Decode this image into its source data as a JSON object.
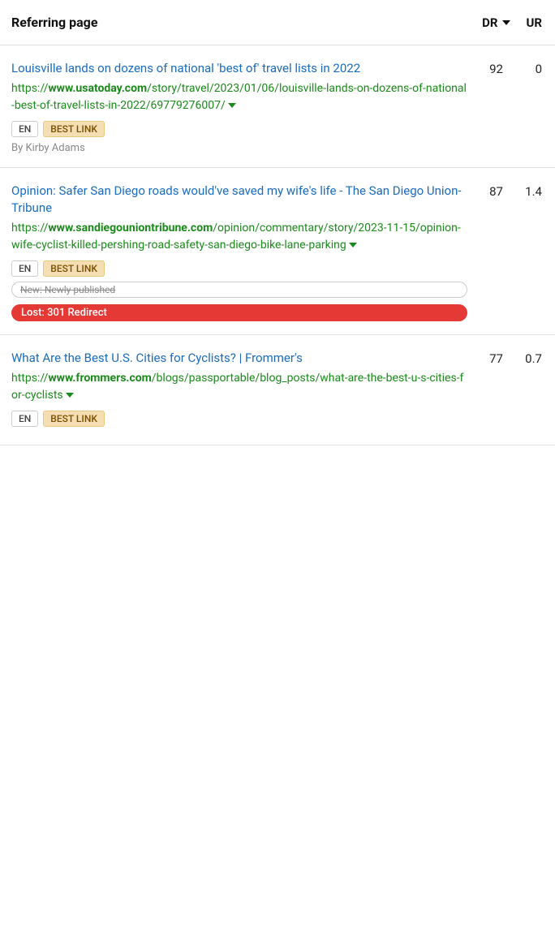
{
  "header": {
    "title": "Referring page",
    "col_dr": "DR",
    "col_ur": "UR"
  },
  "rows": [
    {
      "title": "Louisville lands on dozens of national 'best of' travel lists in 2022",
      "url_prefix": "https://",
      "url_domain": "www.usatoday.com",
      "url_path": "/story/travel/2023/01/06/louisville-lands-on-dozens-of-national-best-of-travel-lists-in-2022/69779276007/",
      "dr": "92",
      "ur": "0",
      "lang": "EN",
      "tag": "BEST LINK",
      "author": "By Kirby Adams",
      "statuses": []
    },
    {
      "title": "Opinion: Safer San Diego roads would've saved my wife's life - The San Diego Union-Tribune",
      "url_prefix": "https://",
      "url_domain": "www.sandiegouniontribune.com",
      "url_path": "/opinion/commentary/story/2023-11-15/opinion-wife-cyclist-killed-pershing-road-safety-san-diego-bike-lane-parking",
      "dr": "87",
      "ur": "1.4",
      "lang": "EN",
      "tag": "BEST LINK",
      "author": "",
      "statuses": [
        {
          "type": "new",
          "text": "New: Newly published"
        },
        {
          "type": "lost",
          "text": "Lost: 301 Redirect"
        }
      ]
    },
    {
      "title": "What Are the Best U.S. Cities for Cyclists? | Frommer's",
      "url_prefix": "https://",
      "url_domain": "www.frommers.com",
      "url_path": "/blogs/passportable/blog_posts/what-are-the-best-u-s-cities-for-cyclists",
      "dr": "77",
      "ur": "0.7",
      "lang": "EN",
      "tag": "BEST LINK",
      "author": "",
      "statuses": []
    }
  ]
}
